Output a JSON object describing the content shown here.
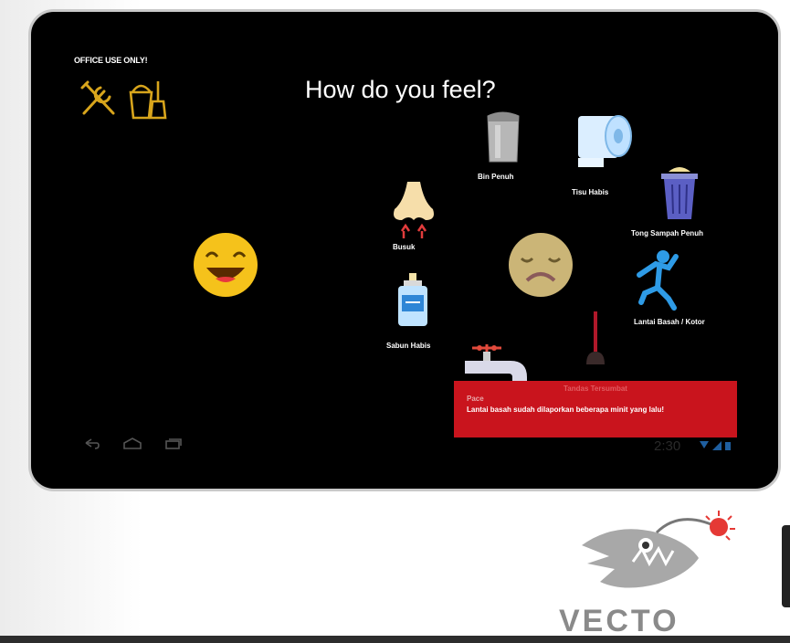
{
  "screen": {
    "office_label": "OFFICE USE ONLY!",
    "title": "How do you feel?"
  },
  "items": [
    {
      "label": "Bin Penuh",
      "icon": "sanitary-bin-icon"
    },
    {
      "label": "Tisu Habis",
      "icon": "toilet-paper-icon"
    },
    {
      "label": "Tong Sampah Penuh",
      "icon": "trash-can-icon"
    },
    {
      "label": "Busuk",
      "icon": "bad-smell-nose-icon"
    },
    {
      "label": "Lantai Basah / Kotor",
      "icon": "slippery-floor-icon"
    },
    {
      "label": "Sabun Habis",
      "icon": "soap-bottle-icon"
    },
    {
      "label": "",
      "icon": "broken-faucet-icon"
    },
    {
      "label": "",
      "icon": "toilet-plunger-icon"
    }
  ],
  "faces": {
    "happy": "happy-face-icon",
    "sad": "sad-face-icon"
  },
  "alert": {
    "back_label": "Tandas Tersumbat",
    "title": "Pace",
    "message": "Lantai basah sudah dilaporkan beberapa minit yang lalu!"
  },
  "status": {
    "time": "2:30"
  },
  "branding": {
    "logo_text": "VECTO"
  },
  "colors": {
    "background": "#000000",
    "alert": "#c9141d",
    "icon_gold": "#d8a51c",
    "face_yellow": "#f5c21b"
  }
}
